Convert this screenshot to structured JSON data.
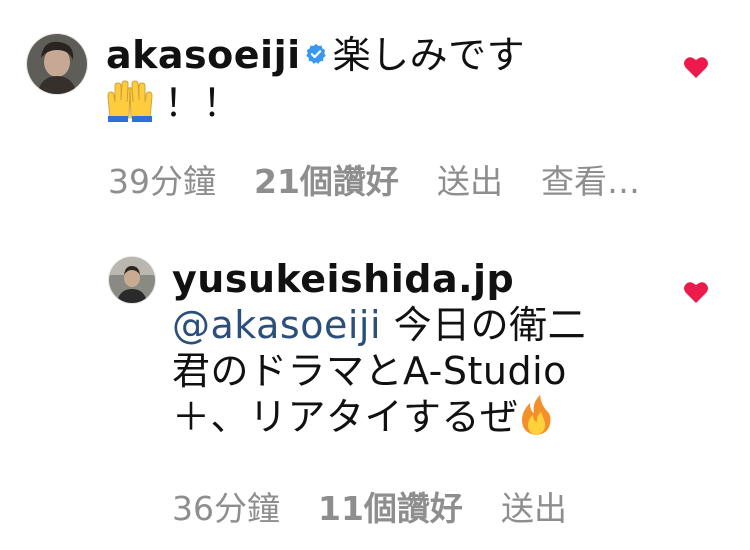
{
  "comments": [
    {
      "username": "akasoeiji",
      "verified": true,
      "text_line1": "楽しみです",
      "text_line2": "！！",
      "emoji_icon": "raising-hands-emoji",
      "time": "39分鐘",
      "likes": "21個讚好",
      "reply": "送出",
      "see_more": "查看…"
    },
    {
      "username": "yusukeishida.jp",
      "verified": false,
      "mention": "@akasoeiji",
      "text_line1": " 今日の衛二",
      "text_line2": "君のドラマとA-Studio",
      "text_line3": "＋、リアタイするぜ",
      "emoji_icon": "fire-emoji",
      "time": "36分鐘",
      "likes": "11個讚好",
      "reply": "送出"
    }
  ],
  "colors": {
    "heart": "#ed1b4b",
    "meta": "#8e8e8e",
    "mention": "#2a4f7b",
    "verified": "#3897f0"
  }
}
